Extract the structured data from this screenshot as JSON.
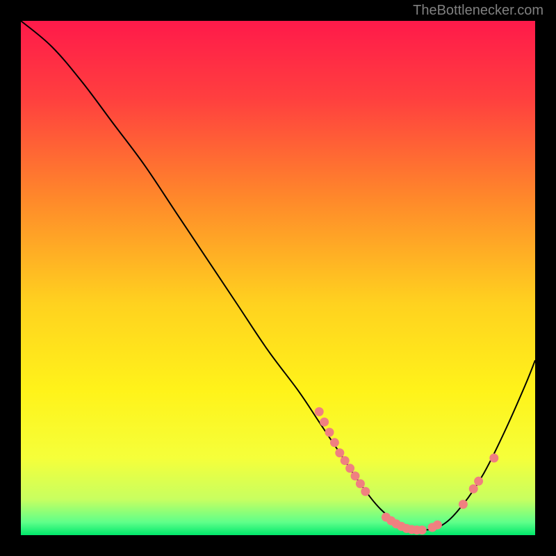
{
  "watermark": "TheBottlenecker.com",
  "gradient": {
    "stops": [
      {
        "offset": 0,
        "color": "#ff1a4a"
      },
      {
        "offset": 0.15,
        "color": "#ff3f3f"
      },
      {
        "offset": 0.35,
        "color": "#ff8a2a"
      },
      {
        "offset": 0.55,
        "color": "#ffd21f"
      },
      {
        "offset": 0.72,
        "color": "#fff31a"
      },
      {
        "offset": 0.85,
        "color": "#f5ff3a"
      },
      {
        "offset": 0.93,
        "color": "#c8ff60"
      },
      {
        "offset": 0.975,
        "color": "#5fff8a"
      },
      {
        "offset": 1.0,
        "color": "#00e86b"
      }
    ]
  },
  "chart_data": {
    "type": "line",
    "title": "",
    "xlabel": "",
    "ylabel": "",
    "xlim": [
      0,
      100
    ],
    "ylim": [
      0,
      100
    ],
    "series": [
      {
        "name": "bottleneck-curve",
        "x": [
          0,
          6,
          12,
          18,
          24,
          30,
          36,
          42,
          48,
          54,
          58,
          62,
          66,
          70,
          74,
          78,
          82,
          86,
          90,
          94,
          98,
          100
        ],
        "y": [
          100,
          95,
          88,
          80,
          72,
          63,
          54,
          45,
          36,
          28,
          22,
          16,
          10,
          5,
          2,
          1,
          2,
          6,
          12,
          20,
          29,
          34
        ]
      }
    ],
    "markers": [
      {
        "x": 58,
        "y": 24
      },
      {
        "x": 59,
        "y": 22
      },
      {
        "x": 60,
        "y": 20
      },
      {
        "x": 61,
        "y": 18
      },
      {
        "x": 62,
        "y": 16
      },
      {
        "x": 63,
        "y": 14.5
      },
      {
        "x": 64,
        "y": 13
      },
      {
        "x": 65,
        "y": 11.5
      },
      {
        "x": 66,
        "y": 10
      },
      {
        "x": 67,
        "y": 8.5
      },
      {
        "x": 71,
        "y": 3.5
      },
      {
        "x": 72,
        "y": 2.8
      },
      {
        "x": 73,
        "y": 2.2
      },
      {
        "x": 74,
        "y": 1.7
      },
      {
        "x": 75,
        "y": 1.3
      },
      {
        "x": 76,
        "y": 1.1
      },
      {
        "x": 77,
        "y": 1.0
      },
      {
        "x": 78,
        "y": 1.0
      },
      {
        "x": 80,
        "y": 1.5
      },
      {
        "x": 81,
        "y": 2.0
      },
      {
        "x": 86,
        "y": 6.0
      },
      {
        "x": 88,
        "y": 9.0
      },
      {
        "x": 89,
        "y": 10.5
      },
      {
        "x": 92,
        "y": 15.0
      }
    ],
    "marker_color": "#f08080",
    "curve_color": "#000000"
  }
}
